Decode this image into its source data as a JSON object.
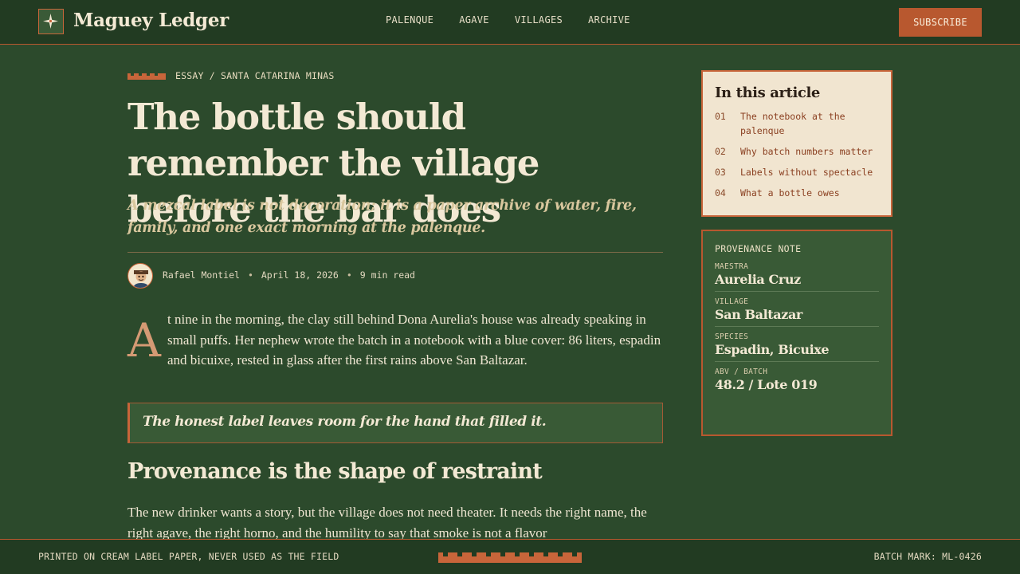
{
  "site": {
    "name": "Maguey Ledger",
    "logo_icon": "four-point-star-icon"
  },
  "nav": {
    "items": [
      "PALENQUE",
      "AGAVE",
      "VILLAGES",
      "ARCHIVE"
    ]
  },
  "header": {
    "subscribe_label": "SUBSCRIBE"
  },
  "article": {
    "kicker": "ESSAY / SANTA CATARINA MINAS",
    "title": "The bottle should remember the village before the bar does",
    "dek": "A mezcal label is not decoration; it is a paper archive of water, fire, family, and one exact morning at the palenque.",
    "author": "Rafael Montiel",
    "date": "April 18, 2026",
    "read_time": "9 min read",
    "dropcap": "A",
    "para1": "t nine in the morning, the clay still behind Dona Aurelia's house was already speaking in small puffs. Her nephew wrote the batch in a notebook with a blue cover: 86 liters, espadin and bicuixe, rested in glass after the first rains above San Baltazar.",
    "pullquote": "The honest label leaves room for the hand that filled it.",
    "h2": "Provenance is the shape of restraint",
    "para2": "The new drinker wants a story, but the village does not need theater. It needs the right name, the right agave, the right horno, and the humility to say that smoke is not a flavor"
  },
  "toc": {
    "title": "In this article",
    "items": [
      {
        "num": "01",
        "label": "The notebook at the palenque"
      },
      {
        "num": "02",
        "label": "Why batch numbers matter"
      },
      {
        "num": "03",
        "label": "Labels without spectacle"
      },
      {
        "num": "04",
        "label": "What a bottle owes"
      }
    ]
  },
  "provenance": {
    "title": "PROVENANCE NOTE",
    "rows": [
      {
        "key": "MAESTRA",
        "value": "Aurelia Cruz"
      },
      {
        "key": "VILLAGE",
        "value": "San Baltazar"
      },
      {
        "key": "SPECIES",
        "value": "Espadin, Bicuixe"
      },
      {
        "key": "ABV / BATCH",
        "value": "48.2 / Lote 019"
      }
    ]
  },
  "footer": {
    "left": "PRINTED ON CREAM LABEL PAPER, NEVER USED AS THE FIELD",
    "right": "BATCH MARK: ML-0426"
  },
  "colors": {
    "page_bg": "#2c4a2c",
    "bar_bg": "#223b22",
    "accent": "#b8582f",
    "cream": "#f1e5d0",
    "panel_green": "#395a36"
  }
}
